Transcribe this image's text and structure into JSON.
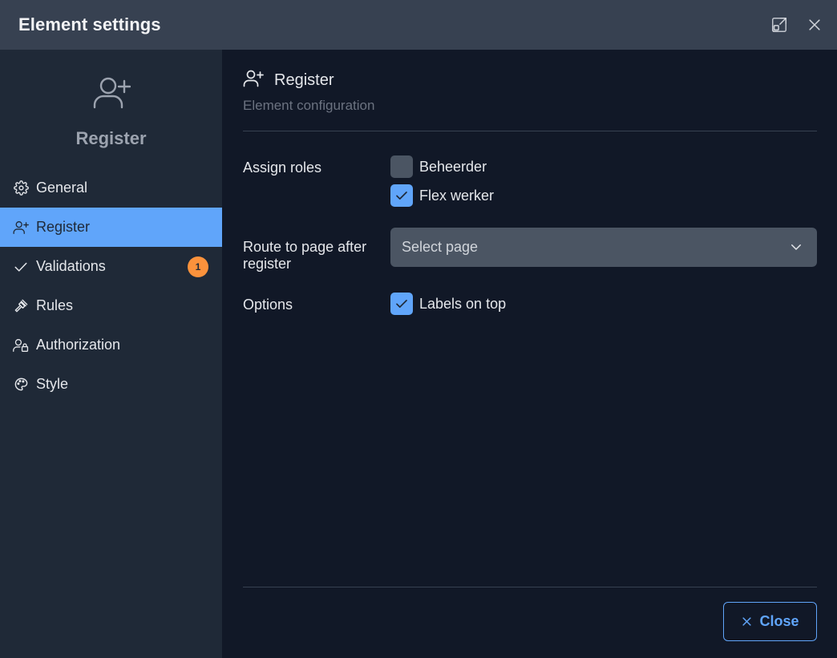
{
  "header": {
    "title": "Element settings",
    "expand_icon": "expand-icon",
    "close_icon": "close-icon"
  },
  "sidebar": {
    "element_icon": "user-plus-icon",
    "element_name": "Register",
    "items": [
      {
        "label": "General",
        "icon": "gear-icon",
        "active": false
      },
      {
        "label": "Register",
        "icon": "user-plus-icon",
        "active": true
      },
      {
        "label": "Validations",
        "icon": "check-icon",
        "active": false,
        "badge": "1"
      },
      {
        "label": "Rules",
        "icon": "gavel-icon",
        "active": false
      },
      {
        "label": "Authorization",
        "icon": "user-lock-icon",
        "active": false
      },
      {
        "label": "Style",
        "icon": "palette-icon",
        "active": false
      }
    ]
  },
  "main": {
    "section_title": "Register",
    "section_subtitle": "Element configuration",
    "assign_roles": {
      "label": "Assign roles",
      "options": [
        {
          "label": "Beheerder",
          "checked": false
        },
        {
          "label": "Flex werker",
          "checked": true
        }
      ]
    },
    "route": {
      "label": "Route to page after register",
      "placeholder": "Select page"
    },
    "options": {
      "label": "Options",
      "items": [
        {
          "label": "Labels on top",
          "checked": true
        }
      ]
    },
    "close_button": "Close"
  },
  "colors": {
    "accent": "#60a5fa",
    "badge": "#fb923c",
    "header_bg": "#374151",
    "sidebar_bg": "#1f2937",
    "main_bg": "#111827"
  }
}
